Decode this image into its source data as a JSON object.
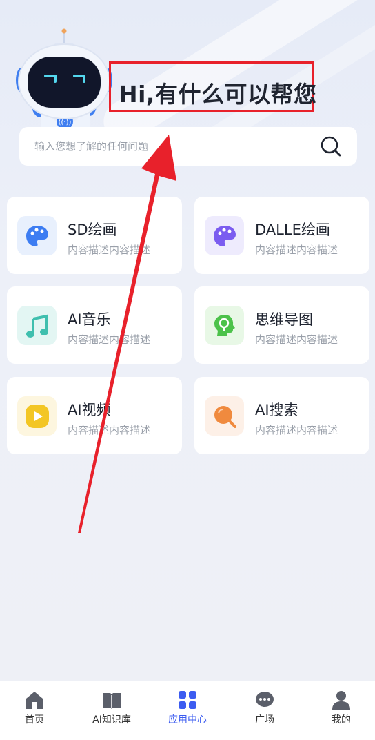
{
  "header": {
    "greeting": "Hi,有什么可以帮您"
  },
  "search": {
    "placeholder": "输入您想了解的任何问题",
    "icon": "search-icon"
  },
  "apps": [
    {
      "title": "SD绘画",
      "desc": "内容描述内容描述",
      "icon": "palette-icon",
      "icon_bg": "#e8f0fd",
      "icon_color": "#3d7df2"
    },
    {
      "title": "DALLE绘画",
      "desc": "内容描述内容描述",
      "icon": "palette-icon",
      "icon_bg": "#eeebfd",
      "icon_color": "#7b5cf0"
    },
    {
      "title": "AI音乐",
      "desc": "内容描述内容描述",
      "icon": "music-note-icon",
      "icon_bg": "#e3f6f3",
      "icon_color": "#3fbfae"
    },
    {
      "title": "思维导图",
      "desc": "内容描述内容描述",
      "icon": "mind-map-icon",
      "icon_bg": "#e8f8e6",
      "icon_color": "#4cc24a"
    },
    {
      "title": "AI视频",
      "desc": "内容描述内容描述",
      "icon": "play-icon",
      "icon_bg": "#fdf6df",
      "icon_color": "#f3c624"
    },
    {
      "title": "AI搜索",
      "desc": "内容描述内容描述",
      "icon": "search-icon",
      "icon_bg": "#fdf0e7",
      "icon_color": "#f08a3e"
    }
  ],
  "tabbar": [
    {
      "label": "首页",
      "icon": "home-icon",
      "active": false
    },
    {
      "label": "AI知识库",
      "icon": "book-icon",
      "active": false
    },
    {
      "label": "应用中心",
      "icon": "grid-icon",
      "active": true
    },
    {
      "label": "广场",
      "icon": "chat-icon",
      "active": false
    },
    {
      "label": "我的",
      "icon": "user-icon",
      "active": false
    }
  ],
  "colors": {
    "accent": "#3c5cf0",
    "annotation": "#e8212b"
  }
}
